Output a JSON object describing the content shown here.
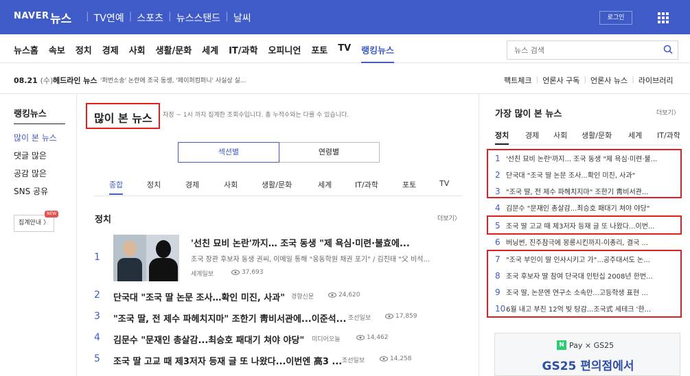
{
  "topbar": {
    "logo": "NAVER",
    "logo_news": "뉴스",
    "nav": [
      "TV연예",
      "스포츠",
      "뉴스스탠드",
      "날씨"
    ],
    "login": "로그인"
  },
  "gnb": {
    "items": [
      "뉴스홈",
      "속보",
      "정치",
      "경제",
      "사회",
      "생활/문화",
      "세계",
      "IT/과학",
      "오피니언",
      "포토",
      "TV",
      "랭킹뉴스"
    ],
    "active": "랭킹뉴스",
    "search_placeholder": "뉴스 검색"
  },
  "headline_bar": {
    "date": "08.21",
    "dow": "(수)",
    "label": "헤드라인 뉴스",
    "text": "'퍼번소송' 논란에 조국 동생, '페이퍼컴퍼니' 사실상 실...",
    "links": [
      "팩트체크",
      "언론사 구독",
      "언론사 뉴스",
      "라이브러리"
    ]
  },
  "left_nav": {
    "title": "랭킹뉴스",
    "items": [
      "많이 본 뉴스",
      "댓글 많은",
      "공감 많은",
      "SNS 공유"
    ],
    "agg_button": "집계안내 〉",
    "new_badge": "NEW"
  },
  "main": {
    "title": "많이 본 뉴스",
    "desc": "자정 ~ 1시 까지 집계한 조회수입니다. 총 누적수와는 다를 수 있습니다.",
    "seg": [
      "섹션별",
      "연령별"
    ],
    "categories": [
      "종합",
      "정치",
      "경제",
      "사회",
      "생활/문화",
      "세계",
      "IT/과학",
      "포토",
      "TV"
    ],
    "section_title": "정치",
    "more": "더보기〉",
    "articles": [
      {
        "rank": "1",
        "title": "'선친 묘비 논란'까지… 조국 동생 \"제 욕심·미련·불효에...",
        "summary": "조국 장관 후보자 동생 권씨, 이메일 통해 \"웅동학원 채권 포기\" / 김진태 \"父 비석...",
        "press": "세계일보",
        "views": "37,693"
      },
      {
        "rank": "2",
        "title": "단국대 \"조국 딸 논문 조사…확인 미진, 사과\"",
        "press": "경향신문",
        "views": "24,620"
      },
      {
        "rank": "3",
        "title": "\"조국 딸, 전 제수 파헤치지마\" 조한기 靑비서관에...이준석...",
        "press": "조선일보",
        "views": "17,859"
      },
      {
        "rank": "4",
        "title": "김문수 \"문재인 총살감...최승호 패대기 쳐야 야당\"",
        "press": "미디어오늘",
        "views": "14,462"
      },
      {
        "rank": "5",
        "title": "조국 딸 고교 때 제3저자 등재 글 또 나왔다...이번엔 高3 ...",
        "press": "조선일보",
        "views": "14,258"
      }
    ]
  },
  "side": {
    "title": "가장 많이 본 뉴스",
    "more": "더보기〉",
    "tabs": [
      "정치",
      "경제",
      "사회",
      "생활/문화",
      "세계",
      "IT/과학"
    ],
    "items": [
      {
        "n": "1",
        "t": "'선친 묘비 논란'까지... 조국 동생 \"제 욕심·미련·불..."
      },
      {
        "n": "2",
        "t": "단국대 \"조국 딸 논문 조사...확인 미진, 사과\""
      },
      {
        "n": "3",
        "t": "\"조국 딸, 전 제수 파헤치지마\" 조한기 靑비서관..."
      },
      {
        "n": "4",
        "t": "김문수 \"문재인 총살감...최승호 패대기 쳐야 야당\""
      },
      {
        "n": "5",
        "t": "조국 딸 고교 때 제3저자 등재 글 또 나왔다...이번..."
      },
      {
        "n": "6",
        "t": "버닝썬, 진주참극에 몽롱시킨까지-이총리, 결국 ..."
      },
      {
        "n": "7",
        "t": "\"조국 부인이 딸 인사시키고 가\"...공주대서도 논..."
      },
      {
        "n": "8",
        "t": "조국 후보자 딸 참여 단국대 인턴십 2008년 한번..."
      },
      {
        "n": "9",
        "t": "조국 딸, 논문엔 연구소 소속만...고등학생 표현 ..."
      },
      {
        "n": "10",
        "t": "6월 내고 부친 12억 빚 탕감...조국式 세테크 '한..."
      }
    ],
    "ad": {
      "pay": "Pay × GS25",
      "n": "N",
      "main": "GS25 편의점에서"
    }
  }
}
